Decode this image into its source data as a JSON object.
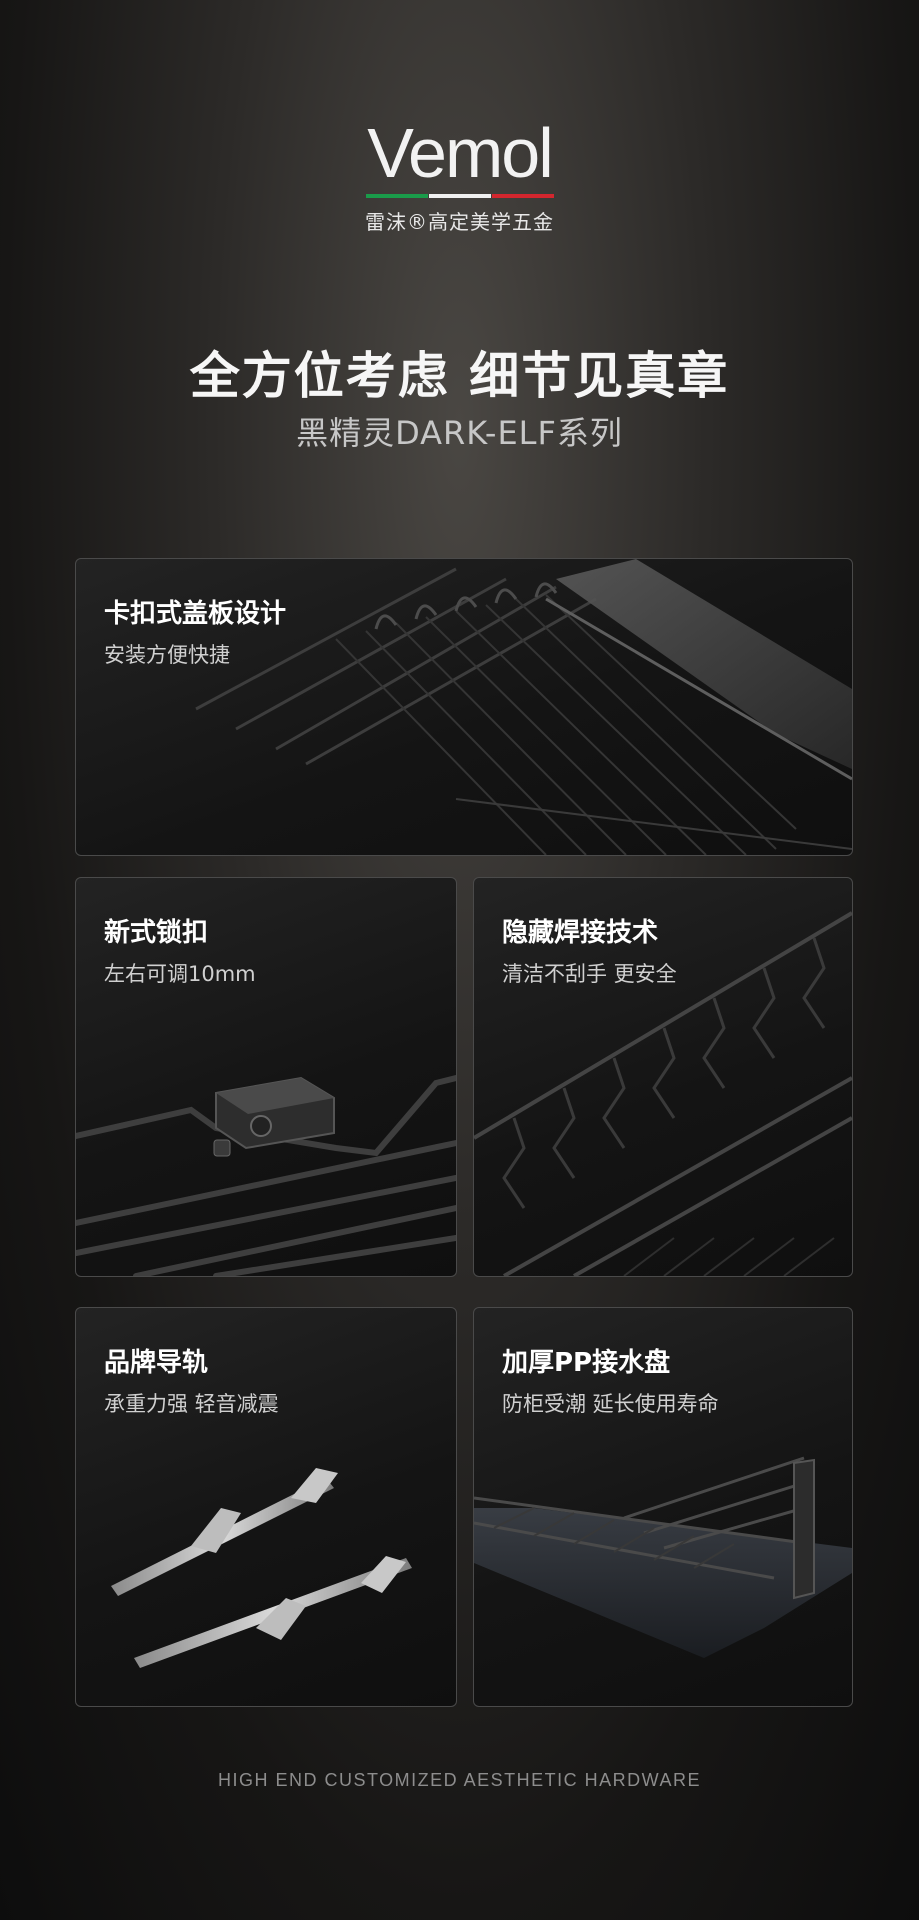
{
  "brand": {
    "wordmark": "Vemol",
    "tagline": "雷沫®高定美学五金"
  },
  "headline": "全方位考虑 细节见真章",
  "subheadline": "黑精灵DARK-ELF系列",
  "features": [
    {
      "title": "卡扣式盖板设计",
      "desc": "安装方便快捷",
      "icon": "cover-plate-rack-photo"
    },
    {
      "title": "新式锁扣",
      "desc": "左右可调10mm",
      "icon": "lock-buckle-photo"
    },
    {
      "title": "隐藏焊接技术",
      "desc": "清洁不刮手 更安全",
      "icon": "wire-weld-photo"
    },
    {
      "title": "品牌导轨",
      "desc": "承重力强 轻音减震",
      "icon": "slide-rail-photo"
    },
    {
      "title": "加厚PP接水盘",
      "desc": "防柜受潮 延长使用寿命",
      "icon": "drip-tray-photo"
    }
  ],
  "footer": "HIGH END CUSTOMIZED AESTHETIC HARDWARE",
  "colors": {
    "flag_green": "#1a9b4a",
    "flag_white": "#f0f0f0",
    "flag_red": "#d3262e",
    "background": "#1c1b1a"
  }
}
